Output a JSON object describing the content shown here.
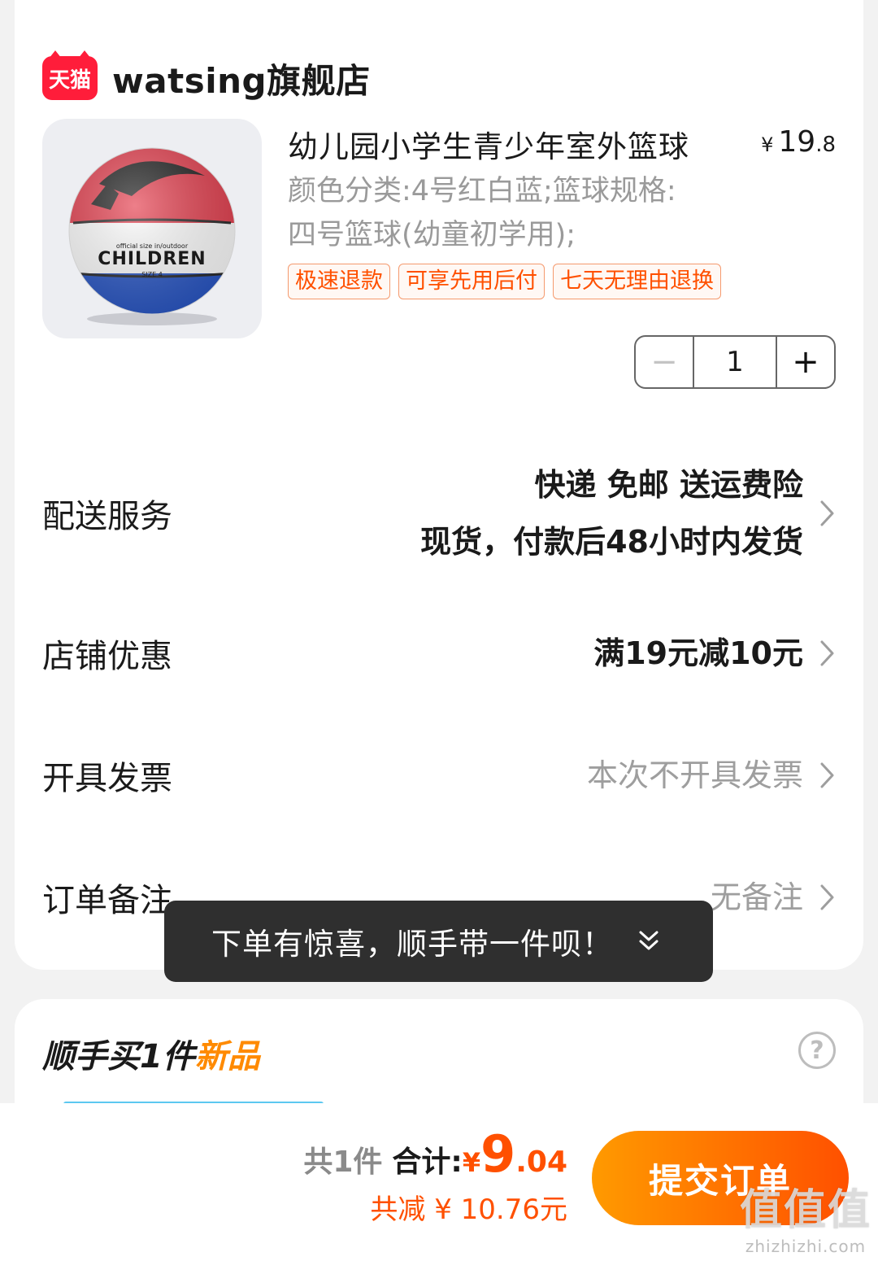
{
  "shop": {
    "logo_text": "天猫",
    "name": "watsing旗舰店"
  },
  "product": {
    "image_label": "CHILDREN",
    "image_small_text": "official size in/outdoor",
    "image_size_text": "SIZE 4",
    "title": "幼儿园小学生青少年室外篮球",
    "price_symbol": "¥",
    "price_int": "19",
    "price_dec": ".8",
    "spec_line1": "颜色分类:4号红白蓝;篮球规格:",
    "spec_line2": "四号篮球(幼童初学用);",
    "tags": [
      "极速退款",
      "可享先用后付",
      "七天无理由退换"
    ],
    "quantity": "1",
    "minus": "−",
    "plus": "+"
  },
  "rows": {
    "delivery": {
      "label": "配送服务",
      "line1": "快递 免邮 送运费险",
      "line2": "现货，付款后48小时内发货"
    },
    "coupon": {
      "label": "店铺优惠",
      "value": "满19元减10元"
    },
    "invoice": {
      "label": "开具发票",
      "value": "本次不开具发票"
    },
    "note": {
      "label": "订单备注",
      "value": "无备注"
    }
  },
  "toast": {
    "text": "下单有惊喜，顺手带一件呗！"
  },
  "addon": {
    "title_prefix": "顺手买1件",
    "title_accent": "新品",
    "help": "?"
  },
  "footer": {
    "count": "共1件",
    "total_label": "合计:",
    "total_symbol": "¥",
    "total_int": "9",
    "total_dec": ".04",
    "discount": "共减 ¥ 10.76元",
    "submit": "提交订单"
  },
  "watermark": {
    "big": "值值值",
    "small": "zhizhizhi.com"
  },
  "colors": {
    "accent": "#ff5000",
    "tag_border": "#f59a6e",
    "brand_red": "#ff1d3a",
    "addon_accent": "#ff8a00"
  }
}
